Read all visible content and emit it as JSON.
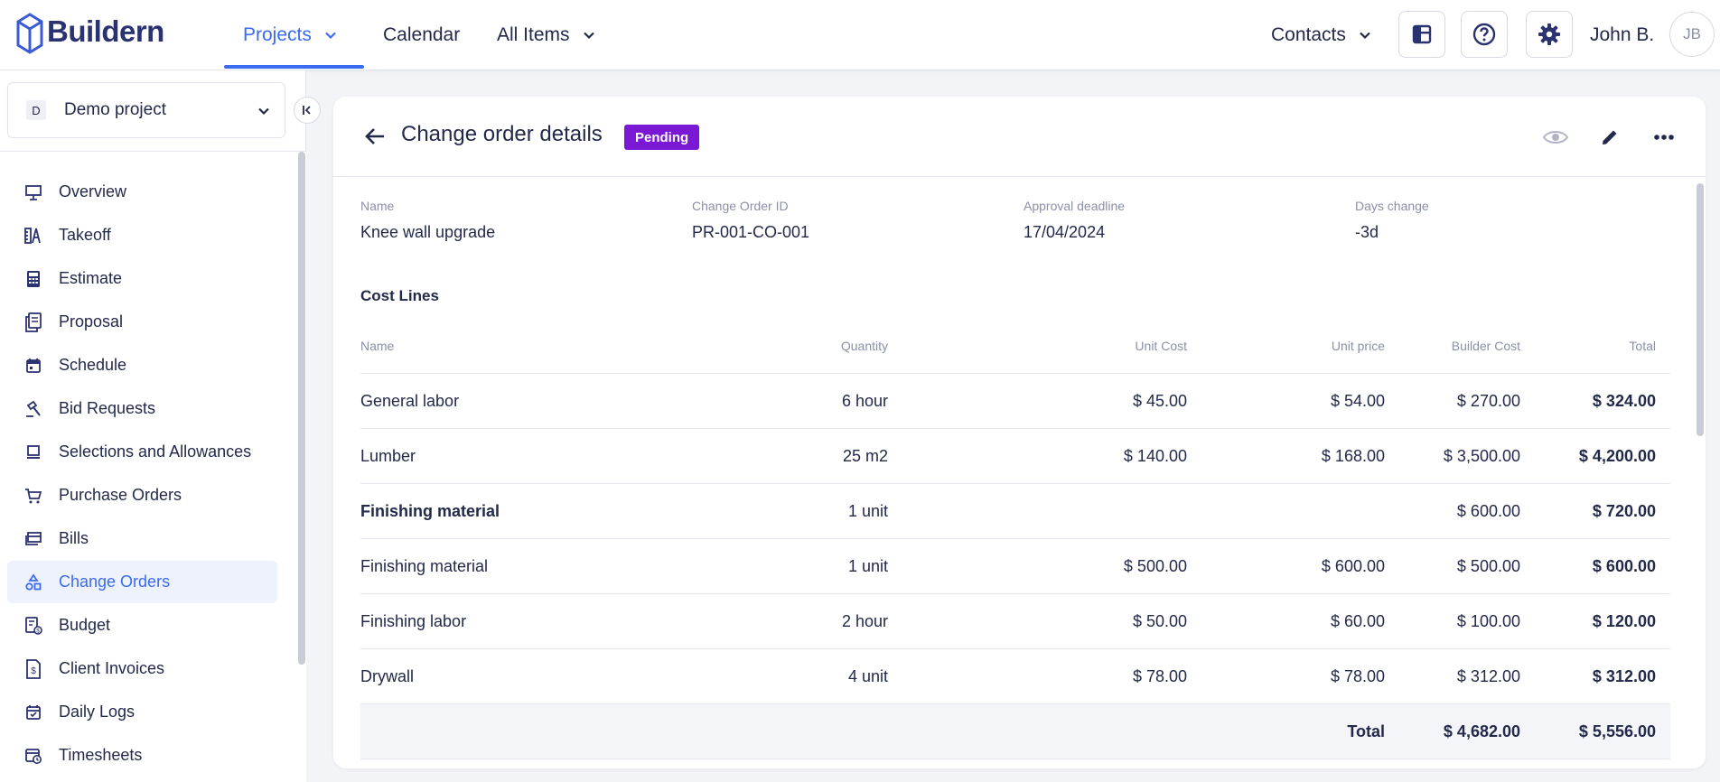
{
  "brand": {
    "name": "Buildern"
  },
  "topnav": {
    "items": [
      {
        "label": "Projects",
        "active": true,
        "has_dropdown": true
      },
      {
        "label": "Calendar",
        "active": false,
        "has_dropdown": false
      },
      {
        "label": "All Items",
        "active": false,
        "has_dropdown": true
      }
    ],
    "contacts_label": "Contacts",
    "user_name": "John B.",
    "user_initials": "JB"
  },
  "sidebar": {
    "project": {
      "badge": "D",
      "name": "Demo project"
    },
    "items": [
      {
        "label": "Overview",
        "icon": "presentation-icon"
      },
      {
        "label": "Takeoff",
        "icon": "takeoff-icon"
      },
      {
        "label": "Estimate",
        "icon": "calculator-icon"
      },
      {
        "label": "Proposal",
        "icon": "proposal-icon"
      },
      {
        "label": "Schedule",
        "icon": "calendar-icon"
      },
      {
        "label": "Bid Requests",
        "icon": "gavel-icon"
      },
      {
        "label": "Selections and Allowances",
        "icon": "selections-icon"
      },
      {
        "label": "Purchase Orders",
        "icon": "cart-icon"
      },
      {
        "label": "Bills",
        "icon": "bills-icon"
      },
      {
        "label": "Change Orders",
        "icon": "shapes-icon",
        "active": true
      },
      {
        "label": "Budget",
        "icon": "budget-icon"
      },
      {
        "label": "Client Invoices",
        "icon": "invoice-icon"
      },
      {
        "label": "Daily Logs",
        "icon": "daily-log-icon"
      },
      {
        "label": "Timesheets",
        "icon": "timesheet-icon"
      }
    ]
  },
  "detail": {
    "title": "Change order details",
    "status": "Pending",
    "fields": [
      {
        "label": "Name",
        "value": "Knee wall upgrade"
      },
      {
        "label": "Change Order ID",
        "value": "PR-001-CO-001"
      },
      {
        "label": "Approval deadline",
        "value": "17/04/2024"
      },
      {
        "label": "Days change",
        "value": "-3d"
      }
    ],
    "cost_lines_title": "Cost Lines",
    "columns": [
      "Name",
      "Quantity",
      "Unit Cost",
      "Unit price",
      "Builder Cost",
      "Total"
    ],
    "rows": [
      {
        "name": "General labor",
        "quantity": "6 hour",
        "unit_cost": "$ 45.00",
        "unit_price": "$ 54.00",
        "builder_cost": "$ 270.00",
        "total": "$ 324.00",
        "group": false
      },
      {
        "name": "Lumber",
        "quantity": "25 m2",
        "unit_cost": "$ 140.00",
        "unit_price": "$ 168.00",
        "builder_cost": "$ 3,500.00",
        "total": "$ 4,200.00",
        "group": false
      },
      {
        "name": "Finishing material",
        "quantity": "1 unit",
        "unit_cost": "",
        "unit_price": "",
        "builder_cost": "$ 600.00",
        "total": "$ 720.00",
        "group": true
      },
      {
        "name": "Finishing material",
        "quantity": "1 unit",
        "unit_cost": "$ 500.00",
        "unit_price": "$ 600.00",
        "builder_cost": "$ 500.00",
        "total": "$ 600.00",
        "group": false
      },
      {
        "name": "Finishing labor",
        "quantity": "2 hour",
        "unit_cost": "$ 50.00",
        "unit_price": "$ 60.00",
        "builder_cost": "$ 100.00",
        "total": "$ 120.00",
        "group": false
      },
      {
        "name": "Drywall",
        "quantity": "4 unit",
        "unit_cost": "$ 78.00",
        "unit_price": "$ 78.00",
        "builder_cost": "$ 312.00",
        "total": "$ 312.00",
        "group": false
      }
    ],
    "totals": {
      "label": "Total",
      "builder_cost": "$ 4,682.00",
      "total": "$ 5,556.00"
    }
  },
  "colors": {
    "accent": "#3b6bf0",
    "brand": "#2b3270",
    "status_pending": "#7b18d6",
    "text": "#23294a",
    "muted": "#8b90a8"
  }
}
